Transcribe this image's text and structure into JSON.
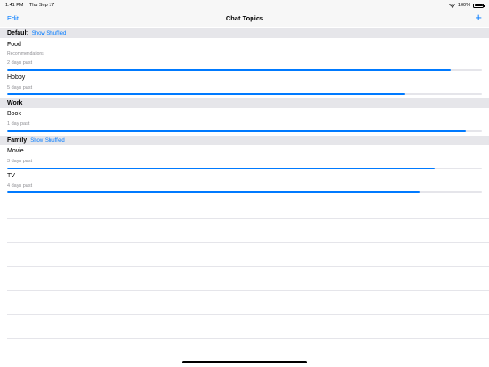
{
  "status": {
    "time": "1:41 PM",
    "date": "Thu Sep 17",
    "battery": "100%",
    "wifi_icon": "wifi-icon",
    "battery_icon": "battery-icon"
  },
  "nav": {
    "edit_label": "Edit",
    "title": "Chat Topics",
    "add_label": "+"
  },
  "sections": [
    {
      "title": "Default",
      "link": "Show Shuffled",
      "rows": [
        {
          "title": "Food",
          "subtitle": "Recommendations",
          "age": "2 days past",
          "progress": 0.935
        },
        {
          "title": "Hobby",
          "age": "5 days past",
          "progress": 0.838
        }
      ]
    },
    {
      "title": "Work",
      "rows": [
        {
          "title": "Book",
          "age": "1 day past",
          "progress": 0.966
        }
      ]
    },
    {
      "title": "Family",
      "link": "Show Shuffled",
      "rows": [
        {
          "title": "Movie",
          "age": "3 days past",
          "progress": 0.902
        },
        {
          "title": "TV",
          "age": "4 days past",
          "progress": 0.869
        }
      ]
    }
  ],
  "colors": {
    "accent": "#007aff",
    "section_bg": "#e6e6ea",
    "secondary_text": "#8e8e93"
  }
}
